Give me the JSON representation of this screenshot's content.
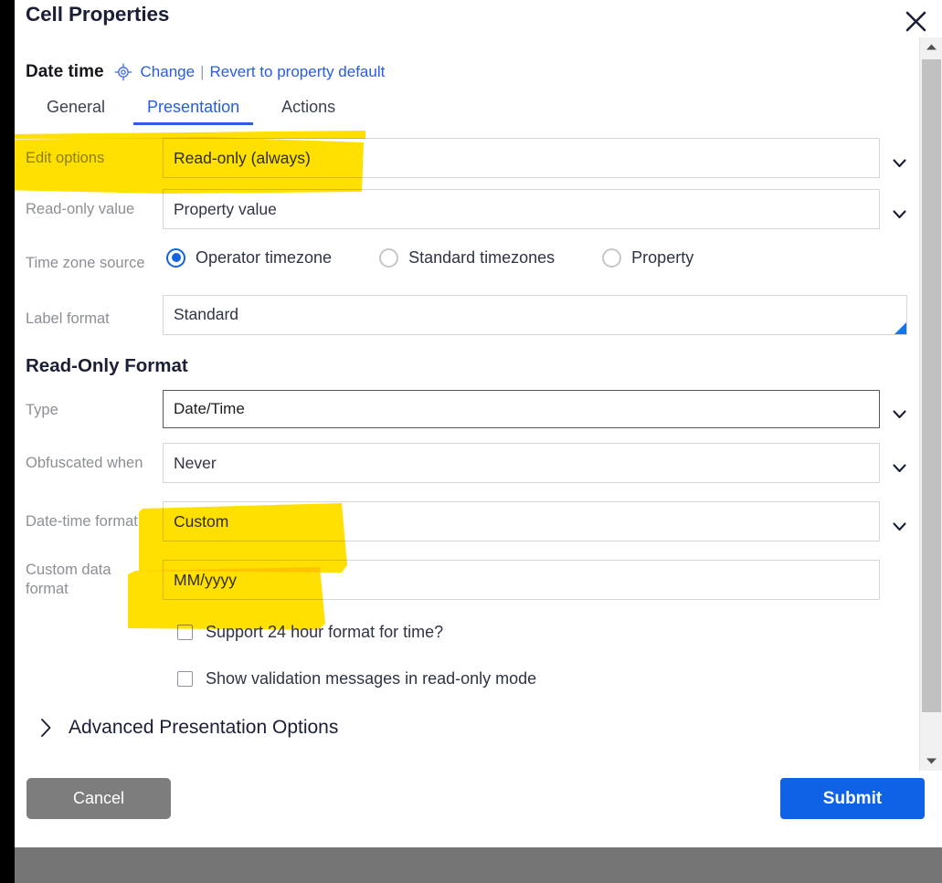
{
  "modal": {
    "title": "Cell Properties",
    "close_icon": "close-icon"
  },
  "property": {
    "name": "Date time",
    "icon": "crosshair-target-icon",
    "change_link": "Change",
    "separator": "|",
    "revert_link": "Revert to property default"
  },
  "tabs": [
    {
      "label": "General",
      "active": false
    },
    {
      "label": "Presentation",
      "active": true
    },
    {
      "label": "Actions",
      "active": false
    }
  ],
  "fields": {
    "edit_options": {
      "label": "Edit options",
      "value": "Read-only (always)",
      "chevron_icon": "chevron-down-icon"
    },
    "read_only_value": {
      "label": "Read-only value",
      "value": "Property value",
      "chevron_icon": "chevron-down-icon"
    },
    "time_zone_source": {
      "label": "Time zone source",
      "options": [
        {
          "label": "Operator timezone",
          "selected": true
        },
        {
          "label": "Standard timezones",
          "selected": false
        },
        {
          "label": "Property",
          "selected": false
        }
      ]
    },
    "label_format": {
      "label": "Label format",
      "value": "Standard",
      "resize_grip_color": "#1a73e8"
    }
  },
  "read_only_format": {
    "heading": "Read-Only Format",
    "type": {
      "label": "Type",
      "value": "Date/Time",
      "chevron_icon": "chevron-down-icon"
    },
    "obfuscated_when": {
      "label": "Obfuscated when",
      "value": "Never",
      "chevron_icon": "chevron-down-icon"
    },
    "date_time_format": {
      "label": "Date-time format",
      "value": "Custom",
      "chevron_icon": "chevron-down-icon"
    },
    "custom_data_format": {
      "label": "Custom data format",
      "value": "MM/yyyy"
    },
    "checkboxes": [
      {
        "label": "Support 24 hour format for time?",
        "checked": false
      },
      {
        "label": "Show validation messages in read-only mode",
        "checked": false
      }
    ]
  },
  "advanced": {
    "label": "Advanced Presentation Options",
    "chevron_icon": "chevron-right-icon",
    "expanded": false
  },
  "footer": {
    "cancel_label": "Cancel",
    "submit_label": "Submit"
  },
  "scrollbar": {
    "up_icon": "caret-up-icon",
    "down_icon": "caret-down-icon"
  },
  "colors": {
    "accent_blue": "#275ce4",
    "submit_blue": "#0f62e6",
    "cancel_grey": "#7d7d7d",
    "highlight_yellow": "#ffe000",
    "label_grey": "#8c8f96"
  }
}
